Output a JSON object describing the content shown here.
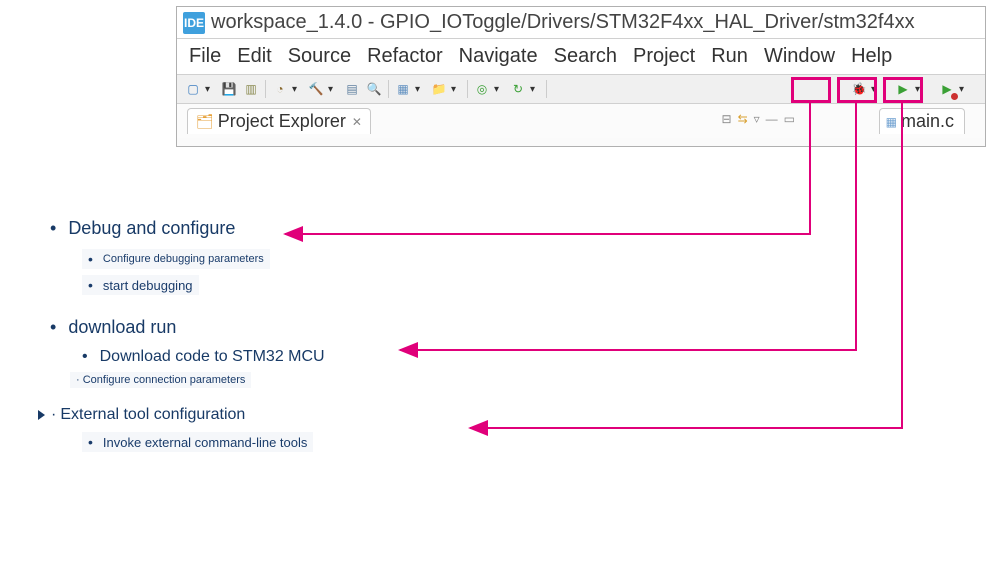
{
  "ide": {
    "icon_text": "IDE",
    "title": "workspace_1.4.0 - GPIO_IOToggle/Drivers/STM32F4xx_HAL_Driver/stm32f4xx",
    "menu": [
      "File",
      "Edit",
      "Source",
      "Refactor",
      "Navigate",
      "Search",
      "Project",
      "Run",
      "Window",
      "Help"
    ],
    "project_explorer_label": "Project Explorer",
    "editor_tab": "main.c"
  },
  "annotations": {
    "debug": {
      "title": "Debug and configure",
      "items": [
        "Configure debugging parameters",
        "start debugging"
      ]
    },
    "download": {
      "title": "download run",
      "sub1": "Download code to STM32 MCU",
      "sub2": "Configure connection parameters"
    },
    "external": {
      "title": "External tool configuration",
      "items": [
        "Invoke external command-line tools"
      ]
    }
  },
  "colors": {
    "callout": "#e0007a",
    "text": "#183a66"
  }
}
